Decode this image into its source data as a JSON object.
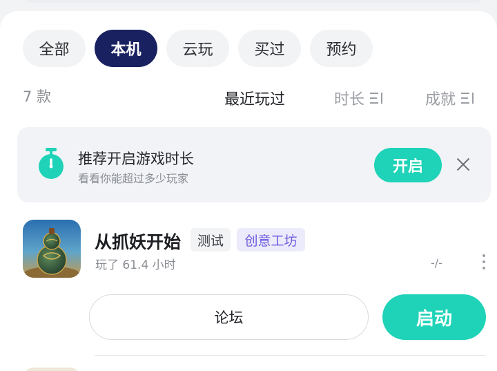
{
  "tabs": [
    {
      "label": "全部",
      "active": false
    },
    {
      "label": "本机",
      "active": true
    },
    {
      "label": "云玩",
      "active": false
    },
    {
      "label": "买过",
      "active": false
    },
    {
      "label": "预约",
      "active": false
    }
  ],
  "list": {
    "count": "7 款",
    "sort_recent": "最近玩过",
    "sort_duration": "时长",
    "sort_achievement": "成就"
  },
  "banner": {
    "title": "推荐开启游戏时长",
    "subtitle": "看看你能超过多少玩家",
    "enable_label": "开启"
  },
  "game": {
    "title": "从抓妖开始",
    "tag_test": "测试",
    "tag_workshop": "创意工坊",
    "play_time": "玩了 61.4 小时",
    "achievement": "-/-",
    "forum_label": "论坛",
    "launch_label": "启动"
  },
  "colors": {
    "accent": "#1ed3b7",
    "active_tab": "#1a2160",
    "workshop_tag_text": "#6c5ae0"
  },
  "icons": [
    "stopwatch-icon",
    "close-icon",
    "sort-icon",
    "more-vertical-icon",
    "gourd-game-icon"
  ]
}
